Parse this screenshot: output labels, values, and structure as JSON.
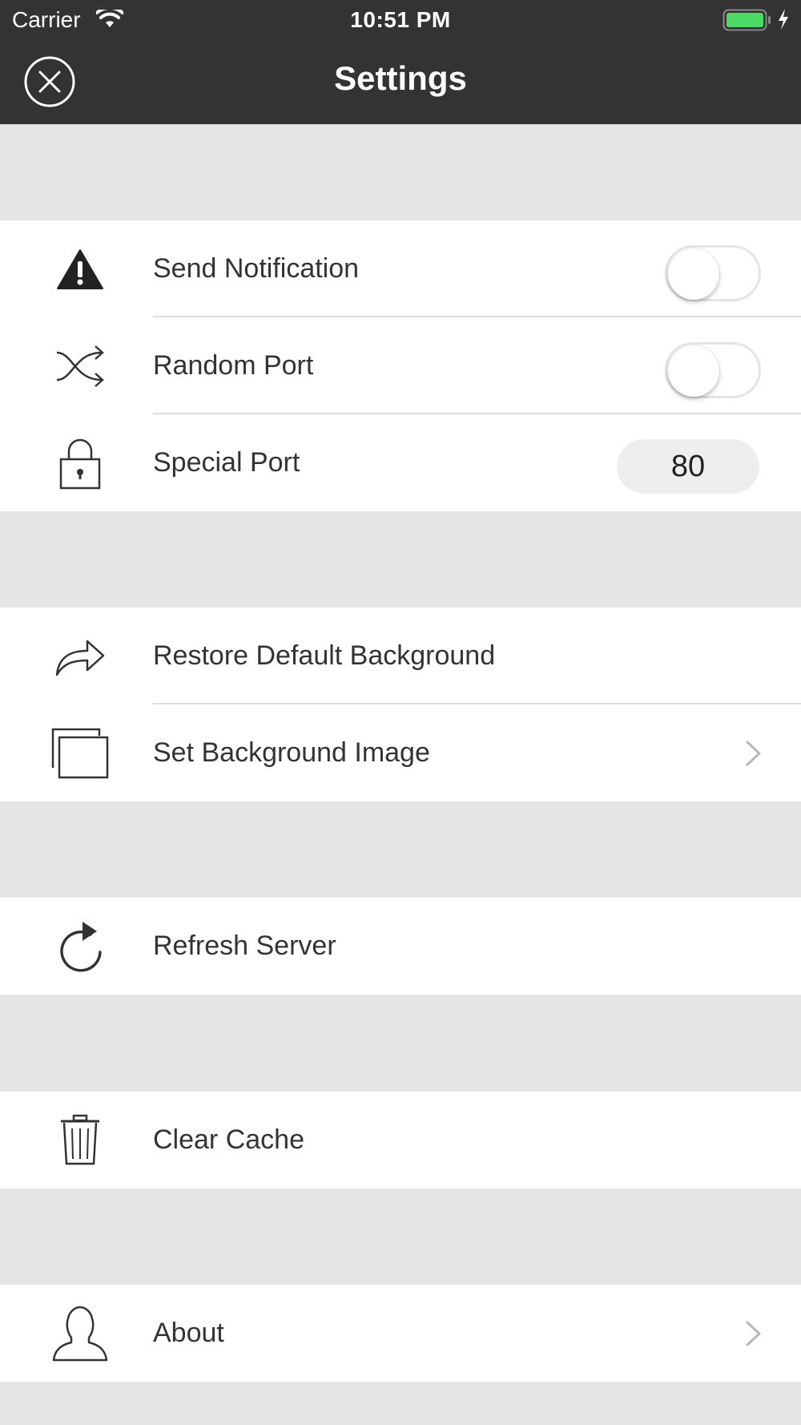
{
  "status_bar": {
    "carrier": "Carrier",
    "time": "10:51 PM",
    "battery_color": "#4cd964"
  },
  "nav": {
    "title": "Settings",
    "close_icon": "close-circle-icon"
  },
  "sections": [
    {
      "rows": [
        {
          "label": "Send Notification",
          "icon": "warning-icon",
          "control": "toggle",
          "toggle_on": false
        },
        {
          "label": "Random Port",
          "icon": "shuffle-icon",
          "control": "toggle",
          "toggle_on": false
        },
        {
          "label": "Special Port",
          "icon": "lock-icon",
          "control": "input",
          "value": "80"
        }
      ]
    },
    {
      "rows": [
        {
          "label": "Restore Default Background",
          "icon": "share-arrow-icon"
        },
        {
          "label": "Set Background Image",
          "icon": "stacked-windows-icon",
          "control": "chevron"
        }
      ]
    },
    {
      "rows": [
        {
          "label": "Refresh Server",
          "icon": "refresh-icon"
        }
      ]
    },
    {
      "rows": [
        {
          "label": "Clear Cache",
          "icon": "trash-icon"
        }
      ]
    },
    {
      "rows": [
        {
          "label": "About",
          "icon": "user-icon",
          "control": "chevron"
        }
      ]
    }
  ],
  "colors": {
    "nav_background": "#333333",
    "page_background": "#e5e5e5",
    "row_background": "#ffffff"
  }
}
